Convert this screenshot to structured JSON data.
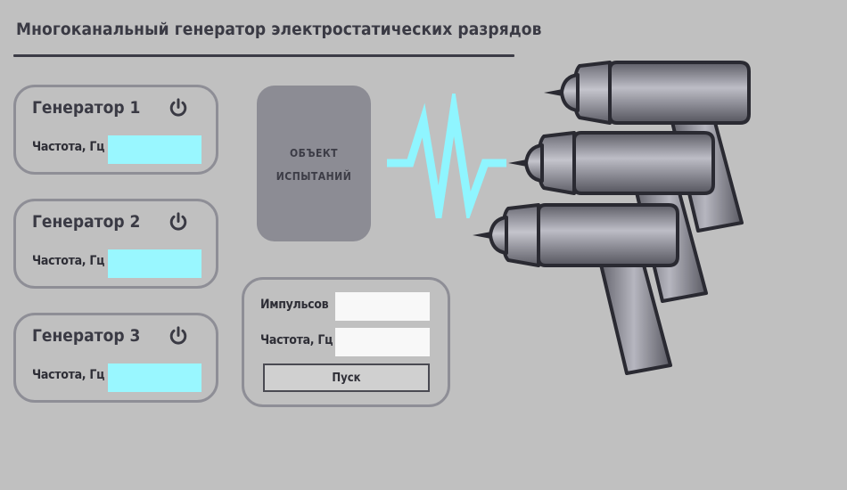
{
  "page": {
    "title": "Многоканальный генератор электростатических разрядов"
  },
  "generators": [
    {
      "title": "Генератор 1",
      "freq_label": "Частота, Гц",
      "freq_value": ""
    },
    {
      "title": "Генератор 2",
      "freq_label": "Частота, Гц",
      "freq_value": ""
    },
    {
      "title": "Генератор 3",
      "freq_label": "Частота, Гц",
      "freq_value": ""
    }
  ],
  "test_object": {
    "label": "ОБЪЕКТ ИСПЫТАНИЙ"
  },
  "control": {
    "pulses_label": "Импульсов",
    "pulses_value": "",
    "freq_label": "Частота, Гц",
    "freq_value": "",
    "start_label": "Пуск"
  },
  "icons": {
    "power": "power-icon",
    "discharge": "discharge-spark-icon",
    "guns": "esd-gun-icon"
  },
  "colors": {
    "background": "#c0c0c0",
    "accent_cyan": "#99f7ff",
    "spark": "#8ff5ff",
    "panel_border": "#8e8e96",
    "object_fill": "#8c8c94",
    "text": "#3a3a44"
  }
}
